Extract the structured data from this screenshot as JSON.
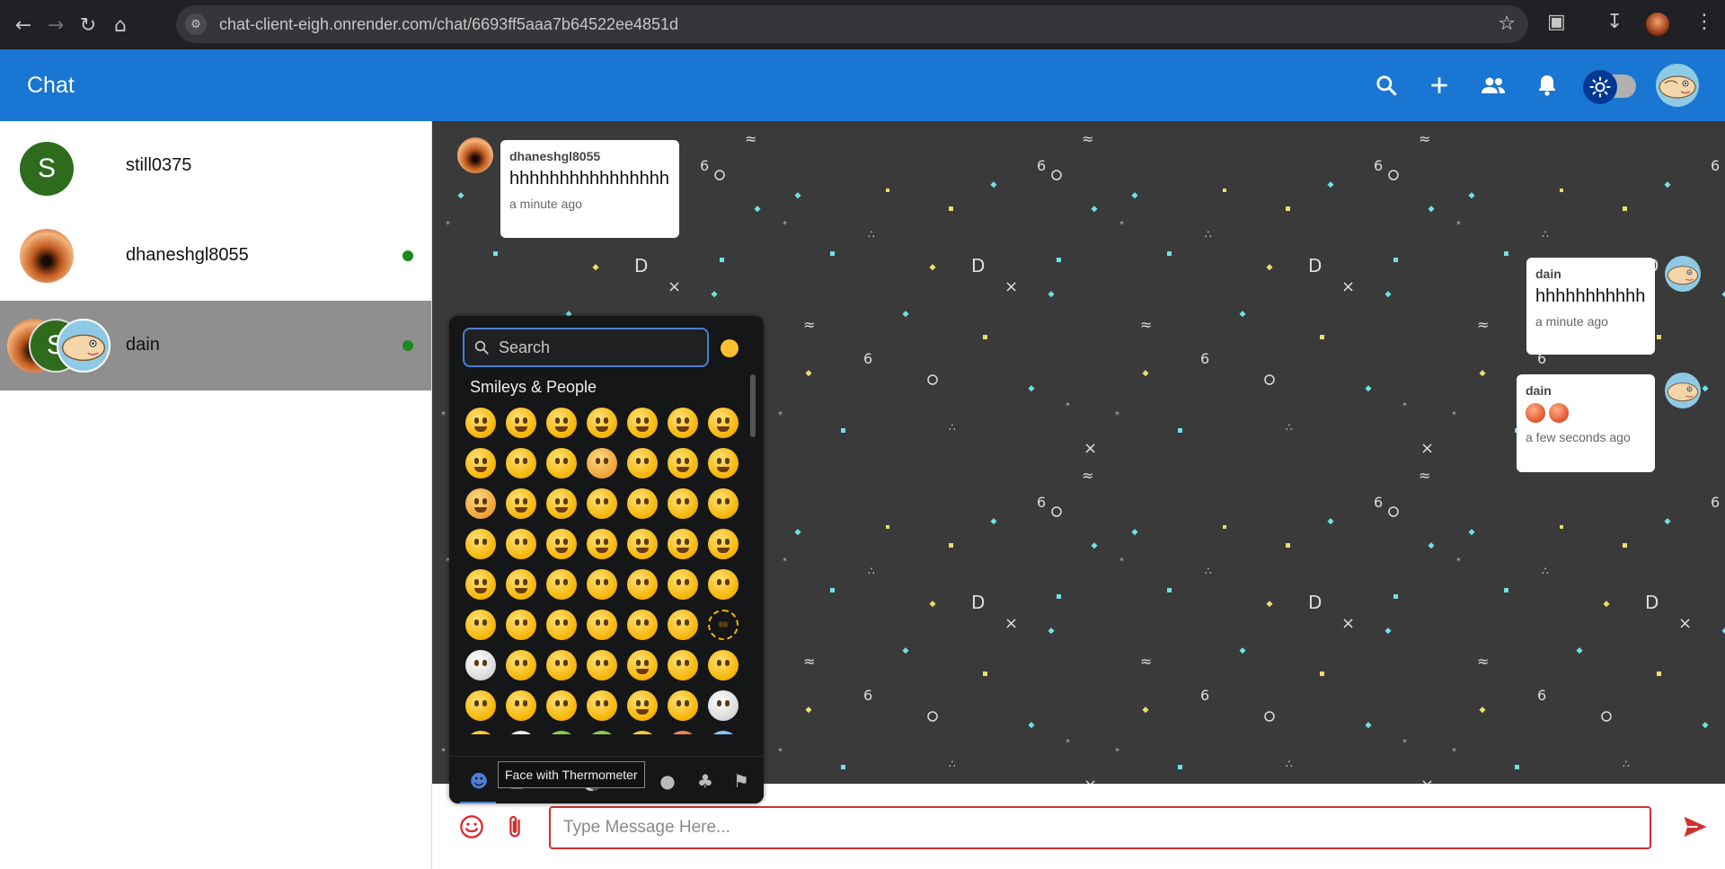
{
  "browser": {
    "url": "chat-client-eigh.onrender.com/chat/6693ff5aaa7b64522ee4851d"
  },
  "appbar": {
    "title": "Chat",
    "icons": [
      "search-icon",
      "add-icon",
      "group-icon",
      "notifications-icon",
      "light-mode-icon"
    ]
  },
  "sidebar": {
    "chats": [
      {
        "name": "still0375",
        "avatar_letter": "S",
        "online": false
      },
      {
        "name": "dhaneshgl8055",
        "online": true
      },
      {
        "name": "dain",
        "online": true,
        "selected": true,
        "group_avatar_letter": "S"
      }
    ]
  },
  "messages": [
    {
      "sender": "dhaneshgl8055",
      "text": "hhhhhhhhhhhhhhhh",
      "time": "a minute ago",
      "side": "left"
    },
    {
      "sender": "dain",
      "text": "hhhhhhhhhhh",
      "time": "a minute ago",
      "side": "right"
    },
    {
      "sender": "dain",
      "text": "",
      "time": "a few seconds ago",
      "side": "right",
      "emojis": 2
    }
  ],
  "emoji_picker": {
    "search_placeholder": "Search",
    "category_label": "Smileys & People",
    "tooltip": "Face with Thermometer",
    "footer_icons": [
      "smiley-category-icon",
      "animals-icon",
      "food-icon",
      "activity-icon",
      "travel-icon",
      "objects-icon",
      "symbols-icon",
      "flags-icon"
    ]
  },
  "composer": {
    "placeholder": "Type Message Here..."
  },
  "colors": {
    "appbar": "#1976d2",
    "chat_background": "#3a3a3a",
    "input_border": "#d32f2f",
    "send_icon": "#d32f2f",
    "online_dot": "#1a8a1a"
  }
}
